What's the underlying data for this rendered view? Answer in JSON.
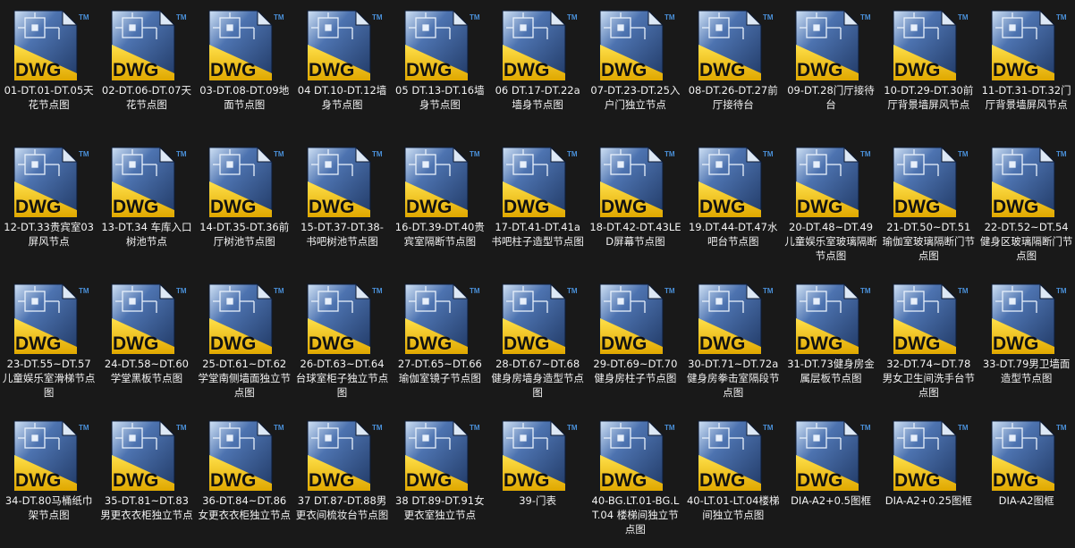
{
  "view": {
    "icon_badge_text": "DWG",
    "icon_tm_mark": "TM",
    "icon_name": "dwg-file-icon",
    "colors": {
      "background": "#191919",
      "label_text": "#f2f2f2",
      "icon_blue": "#2f4f84",
      "icon_yellow": "#f4c400",
      "icon_badge_text": "#111111"
    }
  },
  "files": [
    {
      "name": "01-DT.01-DT.05天花节点图"
    },
    {
      "name": "02-DT.06-DT.07天花节点图"
    },
    {
      "name": "03-DT.08-DT.09地面节点图"
    },
    {
      "name": "04 DT.10-DT.12墙身节点图"
    },
    {
      "name": "05 DT.13-DT.16墙身节点图"
    },
    {
      "name": "06 DT.17-DT.22a墙身节点图"
    },
    {
      "name": "07-DT.23-DT.25入户门独立节点"
    },
    {
      "name": "08-DT.26-DT.27前厅接待台"
    },
    {
      "name": "09-DT.28门厅接待台"
    },
    {
      "name": "10-DT.29-DT.30前厅背景墙屏风节点"
    },
    {
      "name": "11-DT.31-DT.32门厅背景墙屏风节点"
    },
    {
      "name": "12-DT.33贵宾室03屏风节点"
    },
    {
      "name": "13-DT.34 车库入口树池节点"
    },
    {
      "name": "14-DT.35-DT.36前厅树池节点图"
    },
    {
      "name": "15-DT.37-DT.38-书吧树池节点图"
    },
    {
      "name": "16-DT.39-DT.40贵宾室隔断节点图"
    },
    {
      "name": "17-DT.41-DT.41a 书吧柱子造型节点图"
    },
    {
      "name": "18-DT.42-DT.43LED屏幕节点图"
    },
    {
      "name": "19.DT.44-DT.47水吧台节点图"
    },
    {
      "name": "20-DT.48~DT.49儿童娱乐室玻璃隔断节点图"
    },
    {
      "name": "21-DT.50~DT.51瑜伽室玻璃隔断门节点图"
    },
    {
      "name": "22-DT.52~DT.54健身区玻璃隔断门节点图"
    },
    {
      "name": "23-DT.55~DT.57儿童娱乐室滑梯节点图"
    },
    {
      "name": "24-DT.58~DT.60学堂黑板节点图"
    },
    {
      "name": "25-DT.61~DT.62学堂南侧墙面独立节点图"
    },
    {
      "name": "26-DT.63~DT.64台球室柜子独立节点图"
    },
    {
      "name": "27-DT.65~DT.66瑜伽室镜子节点图"
    },
    {
      "name": "28-DT.67~DT.68健身房墙身造型节点图"
    },
    {
      "name": "29-DT.69~DT.70健身房柱子节点图"
    },
    {
      "name": "30-DT.71~DT.72a健身房拳击室隔段节点图"
    },
    {
      "name": "31-DT.73健身房金属层板节点图"
    },
    {
      "name": "32-DT.74~DT.78男女卫生间洗手台节点图"
    },
    {
      "name": "33-DT.79男卫墙面造型节点图"
    },
    {
      "name": "34-DT.80马桶纸巾架节点图"
    },
    {
      "name": "35-DT.81~DT.83男更衣衣柜独立节点"
    },
    {
      "name": "36-DT.84~DT.86女更衣衣柜独立节点"
    },
    {
      "name": "37 DT.87-DT.88男更衣间梳妆台节点图"
    },
    {
      "name": "38 DT.89-DT.91女更衣室独立节点"
    },
    {
      "name": "39-门表"
    },
    {
      "name": "40-BG.LT.01-BG.LT.04 楼梯间独立节点图"
    },
    {
      "name": "40-LT.01-LT.04楼梯间独立节点图"
    },
    {
      "name": "DIA-A2+0.5图框"
    },
    {
      "name": "DIA-A2+0.25图框"
    },
    {
      "name": "DIA-A2图框"
    }
  ]
}
